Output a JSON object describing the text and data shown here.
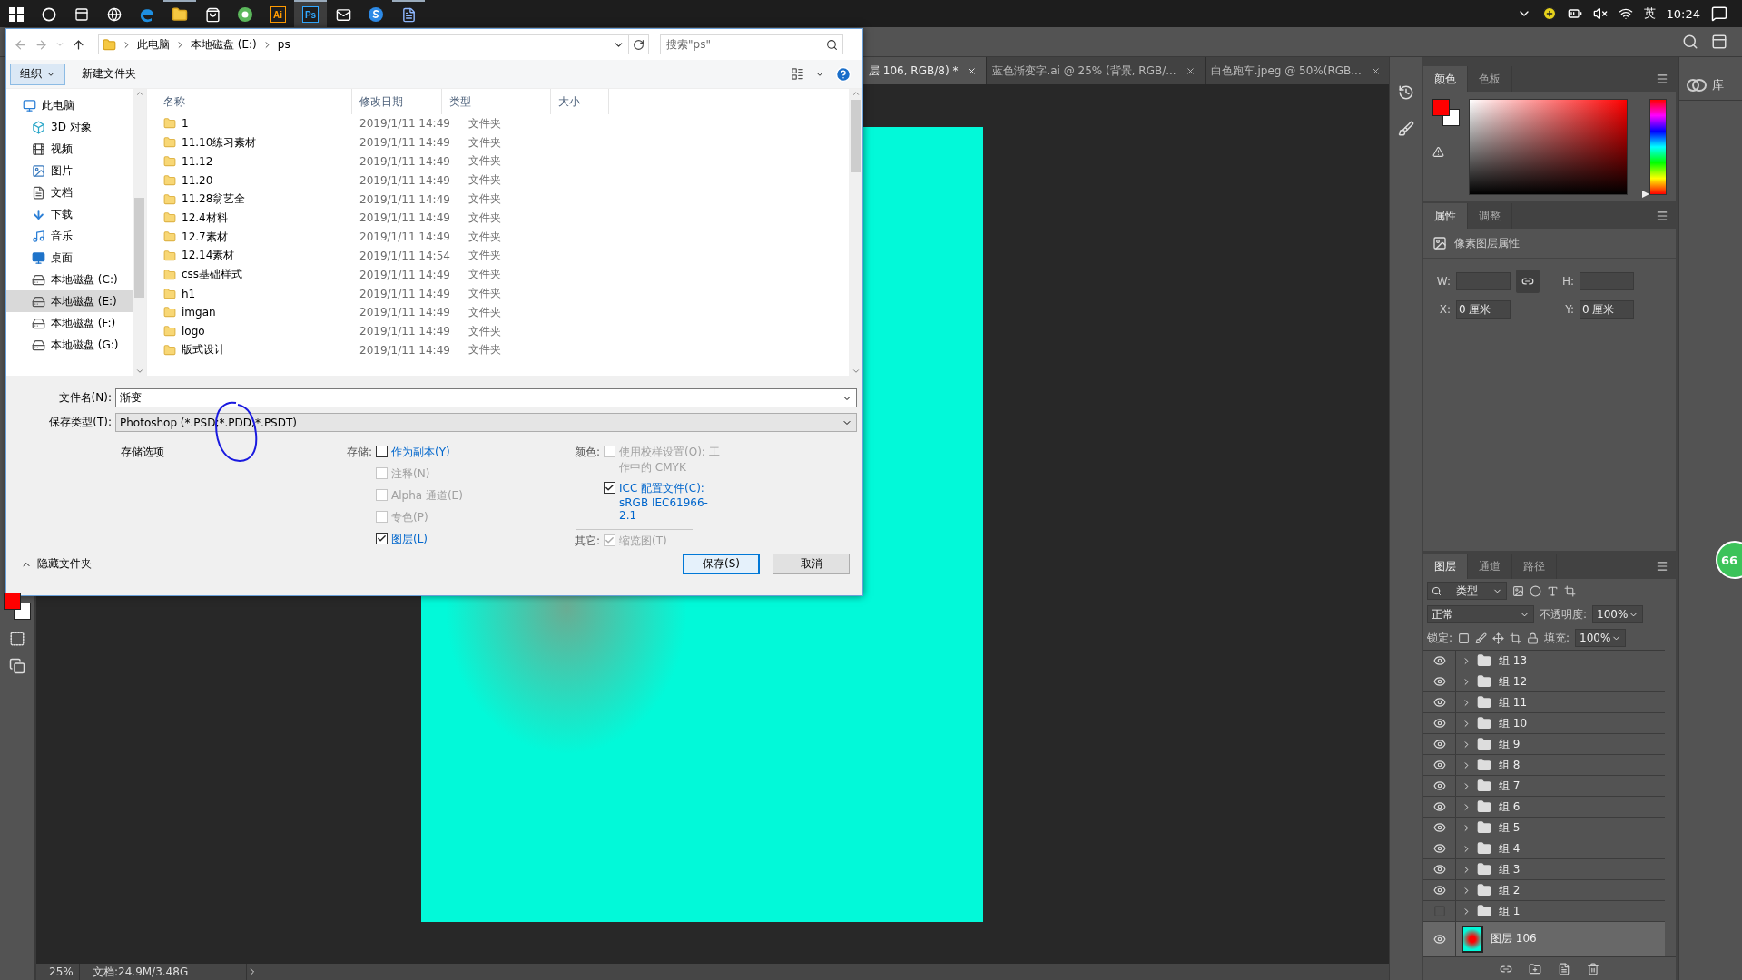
{
  "taskbar": {
    "apps": [
      {
        "kind": "start",
        "active": false,
        "running": false
      },
      {
        "kind": "cortana",
        "active": false,
        "running": false
      },
      {
        "kind": "taskview",
        "active": false,
        "running": false
      },
      {
        "kind": "ie",
        "active": false,
        "running": false
      },
      {
        "kind": "edge",
        "active": false,
        "running": false
      },
      {
        "kind": "explorer",
        "active": false,
        "running": true
      },
      {
        "kind": "store",
        "active": false,
        "running": false
      },
      {
        "kind": "browser",
        "active": false,
        "running": false
      },
      {
        "kind": "tile",
        "label": "Ai",
        "color": "#ff9a00",
        "active": false,
        "running": false
      },
      {
        "kind": "tile",
        "label": "Ps",
        "color": "#31a8ff",
        "active": true,
        "running": true
      },
      {
        "kind": "mail",
        "active": false,
        "running": false
      },
      {
        "kind": "globe",
        "active": false,
        "running": false
      },
      {
        "kind": "doc",
        "active": false,
        "running": true
      }
    ],
    "tray": {
      "input_method": "英",
      "time": "10:24"
    }
  },
  "photoshop": {
    "doc_tabs": [
      {
        "title": "层 106, RGB/8) *",
        "selected": true
      },
      {
        "title": "蓝色渐变字.ai @ 25% (背景, RGB/...",
        "selected": false
      },
      {
        "title": "白色跑车.jpeg @ 50%(RGB...",
        "selected": false
      }
    ],
    "status_bar": {
      "zoom": "25%",
      "doc_info": "文档:24.9M/3.48G"
    },
    "color_panel": {
      "tabs": [
        {
          "label": "颜色",
          "selected": true
        },
        {
          "label": "色板",
          "selected": false
        }
      ],
      "hue": {
        "level": 0
      }
    },
    "properties_panel": {
      "tabs": [
        {
          "label": "属性",
          "selected": true
        },
        {
          "label": "调整",
          "selected": false
        }
      ],
      "title": "像素图层属性",
      "fields": [
        {
          "label": "W:"
        },
        {
          "label": "H:"
        },
        {
          "label": "X:",
          "value": "0 厘米"
        },
        {
          "label": "Y:",
          "value": "0 厘米"
        }
      ]
    },
    "layers_panel": {
      "tabs": [
        {
          "label": "图层",
          "selected": true
        },
        {
          "label": "通道",
          "selected": false
        },
        {
          "label": "路径",
          "selected": false
        }
      ],
      "filter": "类型",
      "blend_mode": "正常",
      "opacity_label": "不透明度:",
      "opacity": "100%",
      "lock_label": "锁定:",
      "fill_label": "填充:",
      "fill": "100%",
      "layers": [
        {
          "name": "组 13",
          "kind": "group",
          "visible": true,
          "selected": false
        },
        {
          "name": "组 12",
          "kind": "group",
          "visible": true,
          "selected": false
        },
        {
          "name": "组 11",
          "kind": "group",
          "visible": true,
          "selected": false
        },
        {
          "name": "组 10",
          "kind": "group",
          "visible": true,
          "selected": false
        },
        {
          "name": "组 9",
          "kind": "group",
          "visible": true,
          "selected": false
        },
        {
          "name": "组 8",
          "kind": "group",
          "visible": true,
          "selected": false
        },
        {
          "name": "组 7",
          "kind": "group",
          "visible": true,
          "selected": false
        },
        {
          "name": "组 6",
          "kind": "group",
          "visible": true,
          "selected": false
        },
        {
          "name": "组 5",
          "kind": "group",
          "visible": true,
          "selected": false
        },
        {
          "name": "组 4",
          "kind": "group",
          "visible": true,
          "selected": false
        },
        {
          "name": "组 3",
          "kind": "group",
          "visible": true,
          "selected": false
        },
        {
          "name": "组 2",
          "kind": "group",
          "visible": true,
          "selected": false
        },
        {
          "name": "组 1",
          "kind": "group",
          "visible": false,
          "selected": false
        },
        {
          "name": "图层 106",
          "kind": "pixel",
          "visible": true,
          "selected": true
        }
      ]
    },
    "libraries": {
      "label": "库"
    },
    "badge": "66"
  },
  "save_dialog": {
    "breadcrumb": [
      "此电脑",
      "本地磁盘 (E:)",
      "ps"
    ],
    "search": {
      "placeholder": "搜索\"ps\""
    },
    "toolbar": {
      "organize": "组织",
      "new_folder": "新建文件夹"
    },
    "nav": [
      {
        "label": "此电脑",
        "kind": "pc",
        "selected": false,
        "children": [
          {
            "label": "3D 对象",
            "kind": "objects",
            "selected": false
          },
          {
            "label": "视频",
            "kind": "video",
            "selected": false
          },
          {
            "label": "图片",
            "kind": "pictures",
            "selected": false
          },
          {
            "label": "文档",
            "kind": "docs",
            "selected": false
          },
          {
            "label": "下载",
            "kind": "downloads",
            "selected": false
          },
          {
            "label": "音乐",
            "kind": "music",
            "selected": false
          },
          {
            "label": "桌面",
            "kind": "desktop",
            "selected": false
          },
          {
            "label": "本地磁盘 (C:)",
            "kind": "drive",
            "selected": false
          },
          {
            "label": "本地磁盘 (E:)",
            "kind": "drive",
            "selected": true
          },
          {
            "label": "本地磁盘 (F:)",
            "kind": "drive",
            "selected": false
          },
          {
            "label": "本地磁盘 (G:)",
            "kind": "drive",
            "selected": false
          }
        ]
      }
    ],
    "columns": [
      "名称",
      "修改日期",
      "类型",
      "大小"
    ],
    "files": [
      {
        "name": "1",
        "modified": "2019/1/11 14:49",
        "type": "文件夹"
      },
      {
        "name": "11.10练习素材",
        "modified": "2019/1/11 14:49",
        "type": "文件夹"
      },
      {
        "name": "11.12",
        "modified": "2019/1/11 14:49",
        "type": "文件夹"
      },
      {
        "name": "11.20",
        "modified": "2019/1/11 14:49",
        "type": "文件夹"
      },
      {
        "name": "11.28翁艺全",
        "modified": "2019/1/11 14:49",
        "type": "文件夹"
      },
      {
        "name": "12.4材料",
        "modified": "2019/1/11 14:49",
        "type": "文件夹"
      },
      {
        "name": "12.7素材",
        "modified": "2019/1/11 14:49",
        "type": "文件夹"
      },
      {
        "name": "12.14素材",
        "modified": "2019/1/11 14:54",
        "type": "文件夹"
      },
      {
        "name": "css基础样式",
        "modified": "2019/1/11 14:49",
        "type": "文件夹"
      },
      {
        "name": "h1",
        "modified": "2019/1/11 14:49",
        "type": "文件夹"
      },
      {
        "name": "imgan",
        "modified": "2019/1/11 14:49",
        "type": "文件夹"
      },
      {
        "name": "logo",
        "modified": "2019/1/11 14:49",
        "type": "文件夹"
      },
      {
        "name": "版式设计",
        "modified": "2019/1/11 14:49",
        "type": "文件夹"
      }
    ],
    "filename": {
      "label": "文件名(N):",
      "value": "渐变"
    },
    "filetype": {
      "label": "保存类型(T):",
      "value": "Photoshop (*.PSD;*.PDD;*.PSDT)"
    },
    "options_title": "存储选项",
    "save_group": {
      "label": "存储:",
      "options": [
        {
          "label": "作为副本(Y)",
          "checked": false,
          "disabled": false
        },
        {
          "label": "注释(N)",
          "checked": false,
          "disabled": true
        },
        {
          "label": "Alpha 通道(E)",
          "checked": false,
          "disabled": true
        },
        {
          "label": "专色(P)",
          "checked": false,
          "disabled": true
        },
        {
          "label": "图层(L)",
          "checked": true,
          "disabled": false
        }
      ]
    },
    "color_group": {
      "label": "颜色:",
      "options": [
        {
          "label": "使用校样设置(O): 工作中的 CMYK",
          "checked": false,
          "disabled": true
        },
        {
          "label": "ICC 配置文件(C):",
          "detail": "sRGB IEC61966-2.1",
          "checked": true,
          "disabled": false
        }
      ]
    },
    "other_group": {
      "label": "其它:",
      "options": [
        {
          "label": "缩览图(T)",
          "checked": true,
          "disabled": true
        }
      ]
    },
    "hide_folders": "隐藏文件夹",
    "buttons": [
      {
        "label": "保存(S)",
        "primary": true
      },
      {
        "label": "取消",
        "primary": false
      }
    ]
  }
}
